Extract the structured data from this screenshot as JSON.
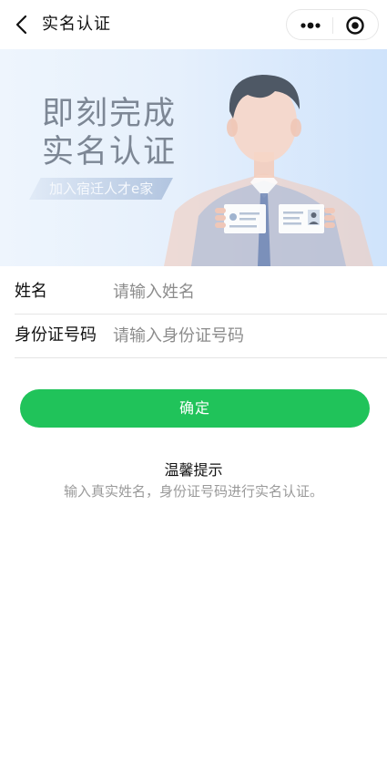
{
  "header": {
    "title": "实名认证",
    "back_icon": "chevron-left-icon",
    "more_icon": "more-dots-icon",
    "target_icon": "target-icon"
  },
  "banner": {
    "headline": "即刻完成\n实名认证",
    "slogan": "加入宿迁人才e家",
    "illustration_icon": "person-holding-id-card-icon"
  },
  "form": {
    "name_label": "姓名",
    "name_placeholder": "请输入姓名",
    "id_label": "身份证号码",
    "id_placeholder": "请输入身份证号码"
  },
  "actions": {
    "confirm_label": "确定"
  },
  "tips": {
    "title": "温馨提示",
    "text": "输入真实姓名，身份证号码进行实名认证。"
  },
  "colors": {
    "accent": "#20c35a",
    "banner_bg": "#e6f0fc",
    "headline": "#7d8795"
  }
}
